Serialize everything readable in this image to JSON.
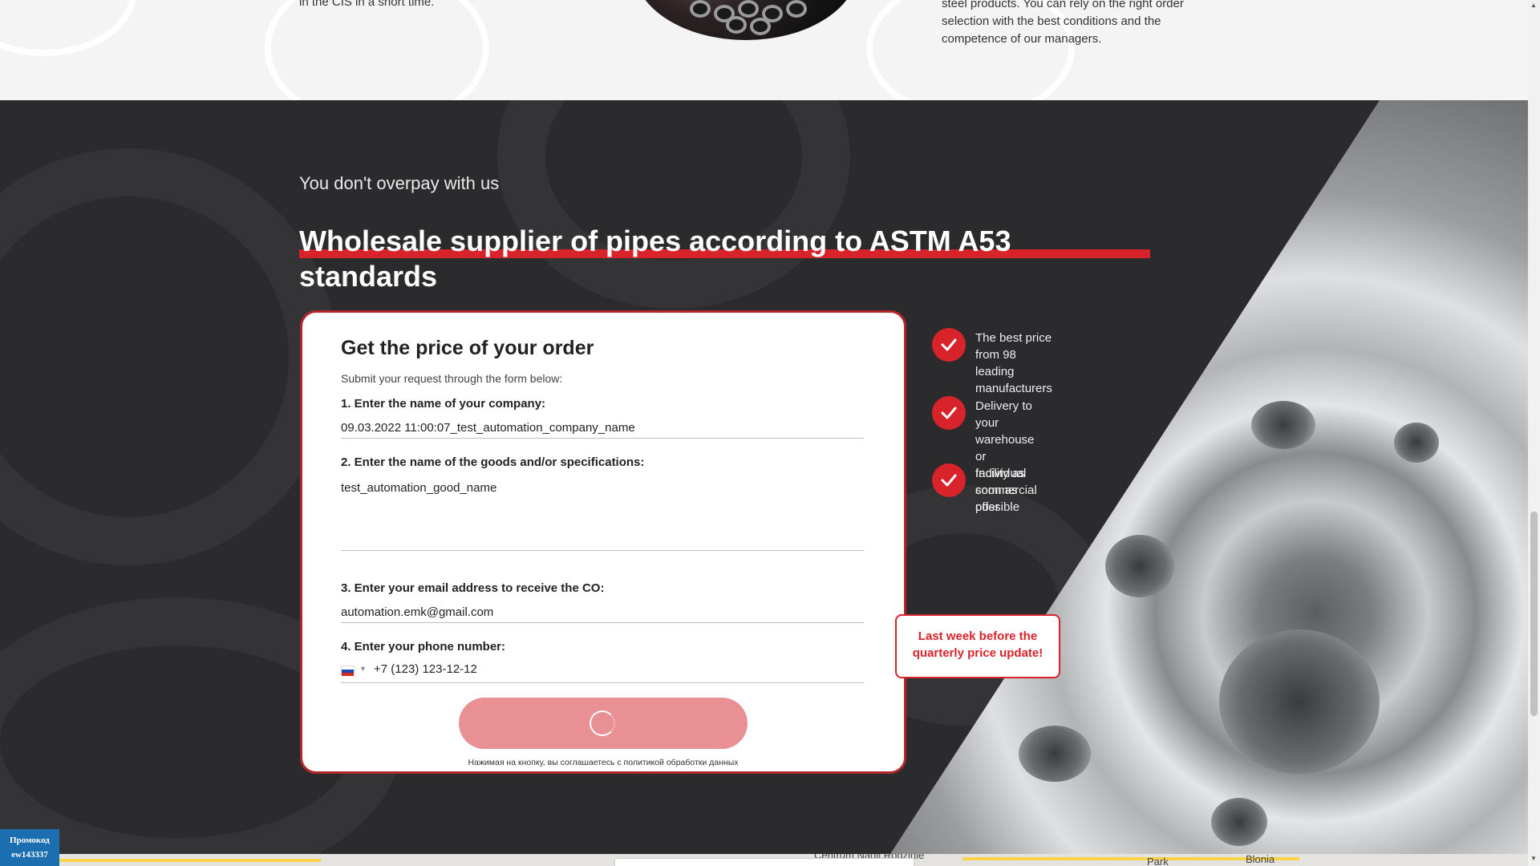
{
  "top_section": {
    "left_text": "in the CIS in a short time.",
    "right_text": "steel products. You can rely on the right order selection with the best conditions and the competence of our managers."
  },
  "hero": {
    "eyebrow": "You don't overpay with us",
    "headline": "Wholesale supplier of pipes according to ASTM A53 standards"
  },
  "form": {
    "title": "Get the price of your order",
    "subtitle": "Submit your request through the form below:",
    "company_label": "1. Enter the name of your company:",
    "company_value": "09.03.2022 11:00:07_test_automation_company_name",
    "goods_label": "2. Enter the name of the goods and/or specifications:",
    "goods_value": "test_automation_good_name",
    "email_label": "3. Enter your email address to receive the CO:",
    "email_value": "automation.emk@gmail.com",
    "phone_label": "4. Enter your phone number:",
    "phone_value": "+7 (123) 123-12-12",
    "consent": "Нажимая на кнопку, вы соглашаетесь с политикой обработки данных"
  },
  "benefits": [
    {
      "line1": "The best price from 98",
      "line2": "leading manufacturers"
    },
    {
      "line1": "Delivery to your warehouse or",
      "line2": "facility as soon as possible"
    },
    {
      "line1": "Individual commercial",
      "line2": "offer"
    }
  ],
  "promo_note": {
    "line1": "Last week before the",
    "line2": "quarterly price update!"
  },
  "promo_badge": {
    "line1": "Промокод",
    "line2": "ew143337"
  },
  "map": {
    "labels": [
      "Centrum Nadii Rodzinie",
      "Park",
      "Blonia"
    ]
  },
  "colors": {
    "accent": "#d8232a",
    "dark_bg": "#2b2b2d",
    "button_loading": "#e99095",
    "badge": "#1b6fb0"
  }
}
